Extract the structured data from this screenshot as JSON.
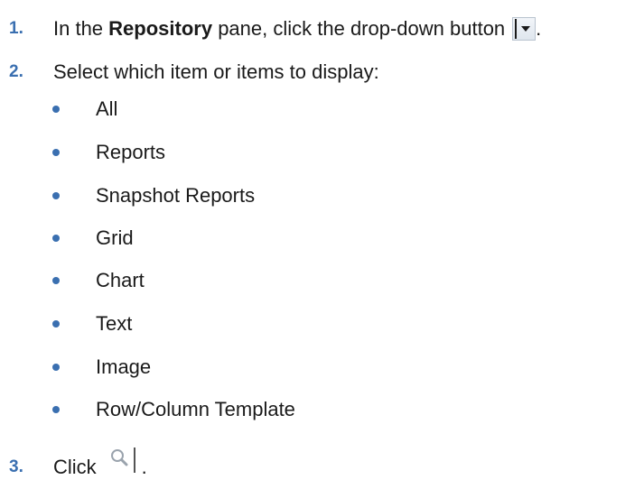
{
  "steps": [
    {
      "number": "1.",
      "text_before": "In the ",
      "bold": "Repository",
      "text_after": " pane, click the drop-down button",
      "end": "."
    },
    {
      "number": "2.",
      "text": "Select which item or items to display:"
    },
    {
      "number": "3.",
      "text": "Click",
      "end": "."
    }
  ],
  "display_options": [
    "All",
    "Reports",
    "Snapshot Reports",
    "Grid",
    "Chart",
    "Text",
    "Image",
    "Row/Column Template"
  ],
  "icons": {
    "dropdown": "chevron-down-icon",
    "search": "magnifier-icon"
  },
  "colors": {
    "accent": "#3a6fb0",
    "text": "#1a1a1a"
  }
}
